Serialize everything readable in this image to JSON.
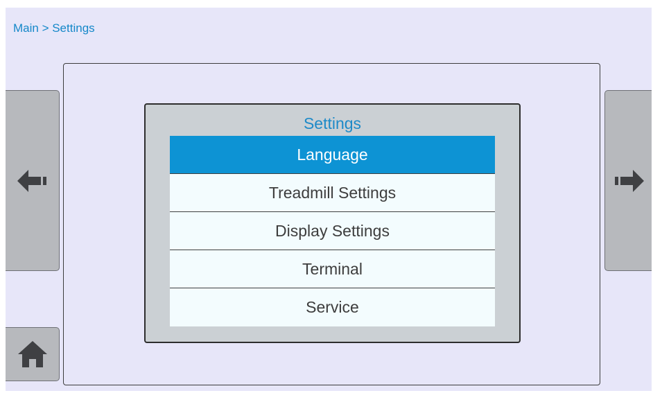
{
  "breadcrumb": {
    "text": "Main > Settings"
  },
  "nav": {
    "left_icon": "arrow-left-icon",
    "right_icon": "arrow-right-icon",
    "home_icon": "home-icon"
  },
  "menu": {
    "title": "Settings",
    "items": [
      {
        "label": "Language",
        "selected": true
      },
      {
        "label": "Treadmill Settings",
        "selected": false
      },
      {
        "label": "Display Settings",
        "selected": false
      },
      {
        "label": "Terminal",
        "selected": false
      },
      {
        "label": "Service",
        "selected": false
      }
    ]
  },
  "colors": {
    "background": "#e7e6f9",
    "accent": "#1588c9",
    "selected_item": "#0d93d4",
    "button_gray": "#b7b9bd"
  }
}
